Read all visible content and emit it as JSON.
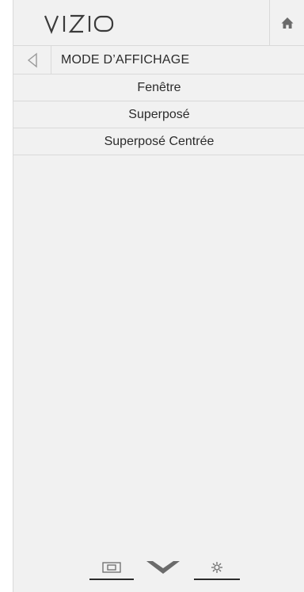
{
  "header": {
    "logo_text": "VIZIO",
    "home_icon": "home-icon"
  },
  "title_row": {
    "back_icon": "back-arrow-icon",
    "title": "MODE D’AFFICHAGE"
  },
  "menu": {
    "items": [
      {
        "label": "Fenêtre"
      },
      {
        "label": "Superposé"
      },
      {
        "label": "Superposé Centrée"
      }
    ]
  },
  "bottom_bar": {
    "items": [
      {
        "icon": "picture-in-picture-icon"
      },
      {
        "icon": "chevron-down-icon"
      },
      {
        "icon": "gear-icon"
      }
    ]
  },
  "colors": {
    "panel_background": "#f1f1f1",
    "divider": "#d9d9d9",
    "text": "#2b2b2b",
    "icon": "#8a8a8a"
  }
}
